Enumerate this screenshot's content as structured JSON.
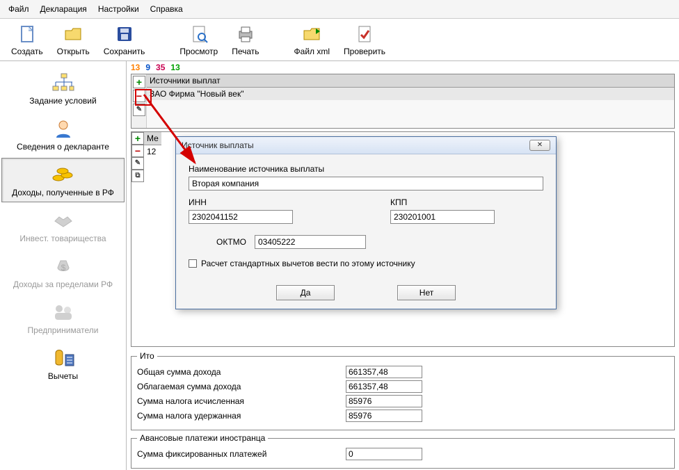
{
  "menu": {
    "file": "Файл",
    "decl": "Декларация",
    "settings": "Настройки",
    "help": "Справка"
  },
  "toolbar": {
    "create": "Создать",
    "open": "Открыть",
    "save": "Сохранить",
    "preview": "Просмотр",
    "print": "Печать",
    "xml": "Файл xml",
    "check": "Проверить"
  },
  "sidebar": {
    "cond": "Задание условий",
    "decl": "Сведения о декларанте",
    "income_rf": "Доходы, полученные в РФ",
    "invest": "Инвест. товарищества",
    "abroad": "Доходы за пределами РФ",
    "entr": "Предприниматели",
    "ded": "Вычеты"
  },
  "rates": [
    "13",
    "9",
    "35",
    "13"
  ],
  "sources": {
    "header": "Источники выплат",
    "rows": [
      "ЗАО Фирма \"Новый век\""
    ]
  },
  "months": {
    "header": "Ме",
    "rows": [
      "12"
    ]
  },
  "results": {
    "legend": "Ито",
    "total_income_l": "Общая сумма дохода",
    "taxable_income_l": "Облагаемая сумма дохода",
    "tax_calc_l": "Сумма налога исчисленная",
    "tax_held_l": "Сумма налога удержанная",
    "total_income": "661357,48",
    "taxable_income": "661357,48",
    "tax_calc": "85976",
    "tax_held": "85976"
  },
  "advance": {
    "legend": "Авансовые платежи иностранца",
    "fixed_l": "Сумма фиксированных платежей",
    "fixed": "0"
  },
  "modal": {
    "title": "Источник выплаты",
    "name_l": "Наименование источника выплаты",
    "name": "Вторая компания",
    "inn_l": "ИНН",
    "inn": "2302041152",
    "kpp_l": "КПП",
    "kpp": "230201001",
    "oktmo_l": "ОКТМО",
    "oktmo": "03405222",
    "checkbox_l": "Расчет стандартных вычетов вести по этому источнику",
    "yes": "Да",
    "no": "Нет"
  }
}
